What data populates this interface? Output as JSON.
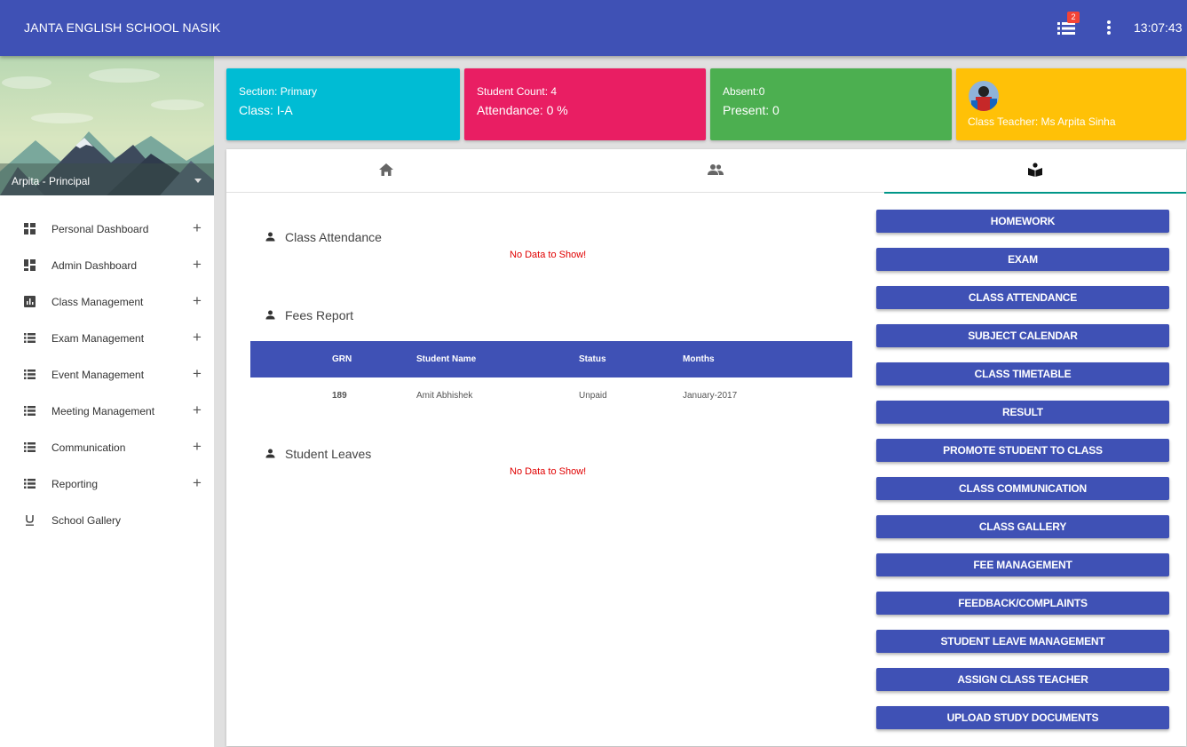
{
  "header": {
    "title": "JANTA ENGLISH SCHOOL NASIK",
    "notification_count": "2",
    "clock": "13:07:43",
    "icons": [
      "list-icon",
      "more-vert-icon"
    ]
  },
  "profile": {
    "user": "Arpita - Principal"
  },
  "sidebar": {
    "items": [
      {
        "label": "Personal Dashboard",
        "icon": "dashboard-icon",
        "expandable": true
      },
      {
        "label": "Admin Dashboard",
        "icon": "dashboard-icon",
        "expandable": true
      },
      {
        "label": "Class Management",
        "icon": "chart-icon",
        "expandable": true
      },
      {
        "label": "Exam Management",
        "icon": "list-icon",
        "expandable": true
      },
      {
        "label": "Event Management",
        "icon": "list-icon",
        "expandable": true
      },
      {
        "label": "Meeting Management",
        "icon": "list-icon",
        "expandable": true
      },
      {
        "label": "Communication",
        "icon": "list-icon",
        "expandable": true
      },
      {
        "label": "Reporting",
        "icon": "list-icon",
        "expandable": true
      },
      {
        "label": "School Gallery",
        "icon": "underline-icon",
        "expandable": false
      }
    ],
    "plus": "+"
  },
  "cards": {
    "section": {
      "line1": "Section: Primary",
      "line2": "Class: I-A",
      "color": "#00bcd4"
    },
    "count": {
      "line1": "Student Count: 4",
      "line2": "Attendance: 0 %",
      "color": "#e91e63"
    },
    "absent": {
      "line1": "Absent:0",
      "line2": "Present: 0",
      "color": "#4caf50"
    },
    "teacher": {
      "line1": "Class Teacher: Ms Arpita Sinha",
      "color": "#ffc107"
    }
  },
  "tabs": [
    {
      "icon": "home-icon",
      "active": false
    },
    {
      "icon": "people-icon",
      "active": false
    },
    {
      "icon": "class-icon",
      "active": true
    }
  ],
  "sections": {
    "attendance": {
      "title": "Class Attendance",
      "empty": "No Data to Show!"
    },
    "fees": {
      "title": "Fees Report"
    },
    "leaves": {
      "title": "Student Leaves",
      "empty": "No Data to Show!"
    }
  },
  "fees_table": {
    "columns": [
      "GRN",
      "Student Name",
      "Status",
      "Months"
    ],
    "rows": [
      [
        "189",
        "Amit Abhishek",
        "Unpaid",
        "January-2017"
      ]
    ]
  },
  "actions": [
    "HOMEWORK",
    "EXAM",
    "CLASS ATTENDANCE",
    "SUBJECT CALENDAR",
    "CLASS TIMETABLE",
    "RESULT",
    "PROMOTE STUDENT TO CLASS",
    "CLASS COMMUNICATION",
    "CLASS GALLERY",
    "FEE MANAGEMENT",
    "FEEDBACK/COMPLAINTS",
    "STUDENT LEAVE MANAGEMENT",
    "ASSIGN CLASS TEACHER",
    "UPLOAD STUDY DOCUMENTS"
  ],
  "colors": {
    "primary": "#3f51b5",
    "accent_tab": "#009688",
    "error_text": "#e00000"
  }
}
